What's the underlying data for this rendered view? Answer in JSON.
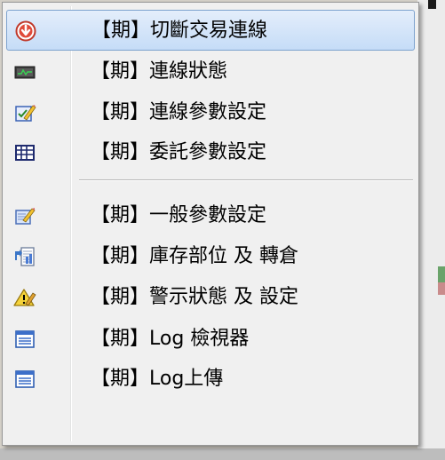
{
  "menu": {
    "items": [
      {
        "label": "【期】切斷交易連線",
        "icon": "disconnect-icon",
        "highlighted": true
      },
      {
        "label": "【期】連線狀態",
        "icon": "connection-status-icon"
      },
      {
        "label": "【期】連線參數設定",
        "icon": "connection-settings-icon"
      },
      {
        "label": "【期】委託參數設定",
        "icon": "order-settings-grid-icon"
      },
      {
        "label": "【期】一般參數設定",
        "icon": "general-settings-icon"
      },
      {
        "label": "【期】庫存部位 及 轉倉",
        "icon": "inventory-position-icon"
      },
      {
        "label": "【期】警示狀態 及 設定",
        "icon": "warning-settings-icon"
      },
      {
        "label": "【期】Log 檢視器",
        "icon": "log-viewer-icon"
      },
      {
        "label": "【期】Log上傳",
        "icon": "log-upload-icon"
      }
    ]
  },
  "colors": {
    "highlight_top": "#e4eefb",
    "highlight_bottom": "#c5dcf7",
    "highlight_border": "#7da2ce",
    "menu_bg": "#f0f0f0"
  }
}
